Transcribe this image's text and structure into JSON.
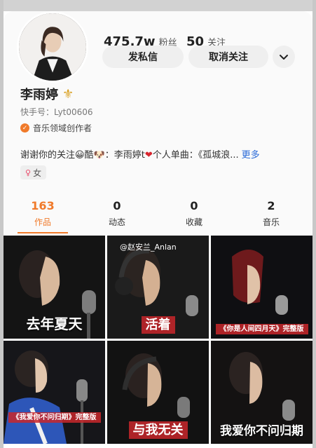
{
  "profile": {
    "fans_count": "475.7w",
    "fans_label": "粉丝",
    "following_count": "50",
    "following_label": "关注",
    "message_button": "发私信",
    "unfollow_button": "取消关注",
    "name": "李雨婷",
    "name_badge_icon": "fleur-de-lis-icon",
    "kuaishou_id": "快手号：Lyt00606",
    "creator_label": "音乐领域创作者",
    "bio_text": "谢谢你的关注😀酷🐶：李雨婷t",
    "bio_text_2": "个人单曲：《孤城浪...",
    "bio_more": "更多",
    "gender_label": "女",
    "colors": {
      "accent": "#f07a2a",
      "link": "#2b6bd8"
    }
  },
  "tabs": [
    {
      "count": "163",
      "label": "作品",
      "active": true
    },
    {
      "count": "0",
      "label": "动态",
      "active": false
    },
    {
      "count": "0",
      "label": "收藏",
      "active": false
    },
    {
      "count": "2",
      "label": "音乐",
      "active": false
    }
  ],
  "videos": [
    {
      "caption": "去年夏天",
      "style": "plain"
    },
    {
      "caption": "活着",
      "style": "red",
      "watermark": "@赵安兰_Anlan"
    },
    {
      "caption": "《你是人间四月天》完整版",
      "style": "red-small"
    },
    {
      "caption": "《我爱你不问归期》完整版",
      "style": "red-small"
    },
    {
      "caption": "与我无关",
      "style": "red"
    },
    {
      "caption": "我爱你不问归期",
      "style": "plain"
    }
  ]
}
